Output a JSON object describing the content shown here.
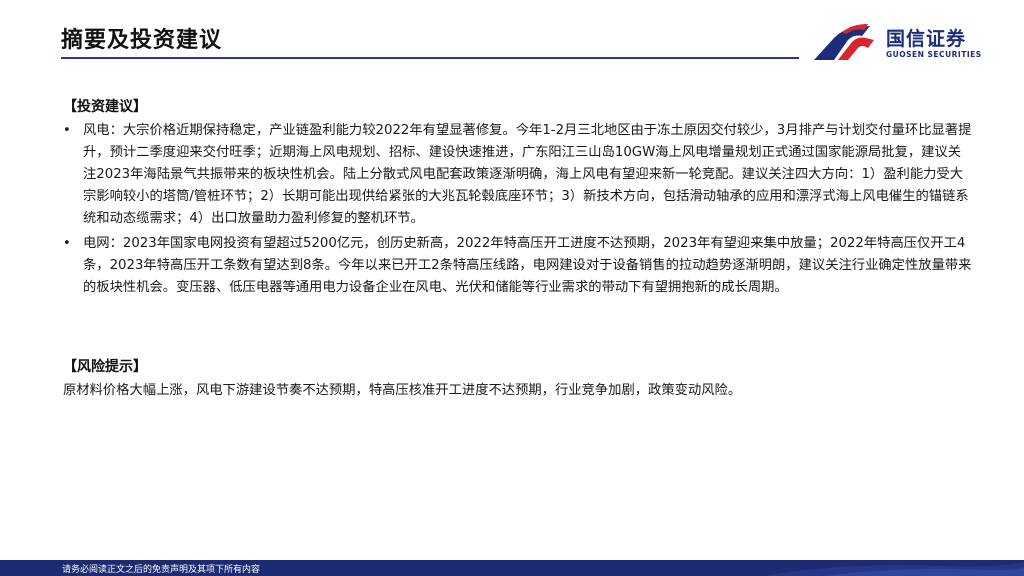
{
  "header": {
    "title": "摘要及投资建议"
  },
  "logo": {
    "name_cn": "国信证券",
    "name_en": "GUOSEN SECURITIES",
    "colors": {
      "blue": "#1d2d7a",
      "red": "#d7262c"
    }
  },
  "investment": {
    "heading": "【投资建议】",
    "items": [
      "风电：大宗价格近期保持稳定，产业链盈利能力较2022年有望显著修复。今年1-2月三北地区由于冻土原因交付较少，3月排产与计划交付量环比显著提升，预计二季度迎来交付旺季；近期海上风电规划、招标、建设快速推进，广东阳江三山岛10GW海上风电增量规划正式通过国家能源局批复，建议关注2023年海陆景气共振带来的板块性机会。陆上分散式风电配套政策逐渐明确，海上风电有望迎来新一轮竞配。建议关注四大方向：1）盈利能力受大宗影响较小的塔筒/管桩环节；2）长期可能出现供给紧张的大兆瓦轮毂底座环节；3）新技术方向，包括滑动轴承的应用和漂浮式海上风电催生的锚链系统和动态缆需求；4）出口放量助力盈利修复的整机环节。",
      "电网：2023年国家电网投资有望超过5200亿元，创历史新高，2022年特高压开工进度不达预期，2023年有望迎来集中放量；2022年特高压仅开工4条，2023年特高压开工条数有望达到8条。今年以来已开工2条特高压线路，电网建设对于设备销售的拉动趋势逐渐明朗，建议关注行业确定性放量带来的板块性机会。变压器、低压电器等通用电力设备企业在风电、光伏和储能等行业需求的带动下有望拥抱新的成长周期。"
    ]
  },
  "risk": {
    "heading": "【风险提示】",
    "text": "原材料价格大幅上涨，风电下游建设节奏不达预期，特高压核准开工进度不达预期，行业竞争加剧，政策变动风险。"
  },
  "footer": {
    "disclaimer": "请务必阅读正文之后的免责声明及其项下所有内容",
    "color": "#1d2b73"
  },
  "accent_color": "#2b3a8f",
  "bullet_symbol": "•"
}
